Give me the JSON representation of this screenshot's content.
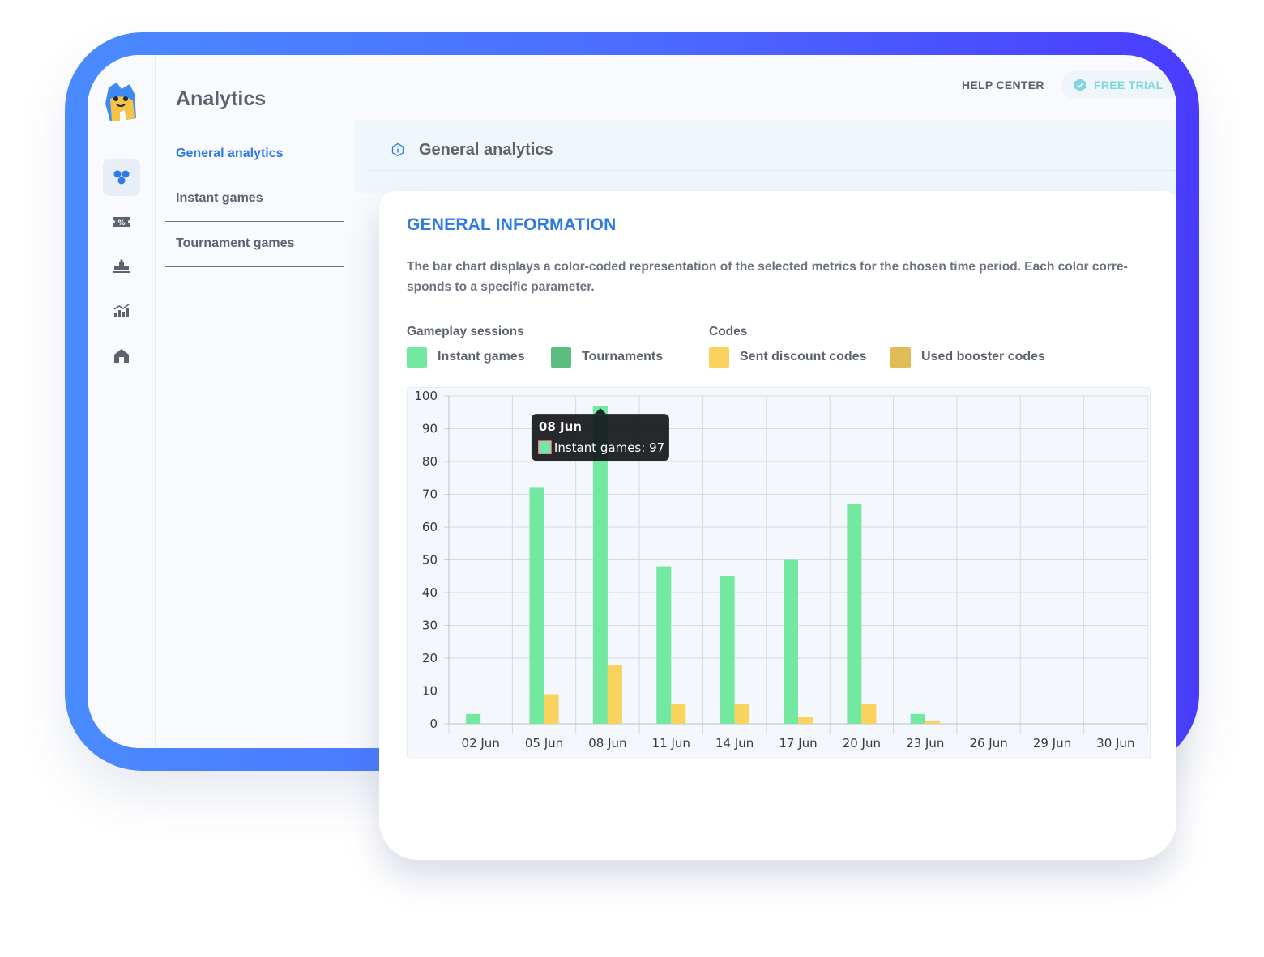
{
  "app": {
    "page_title": "Analytics",
    "help_center": "HELP CENTER",
    "free_trial": "FREE TRIAL",
    "accent_color": "#2f7ae5",
    "frame_gradient": [
      "#4a8bff",
      "#4a3cff"
    ]
  },
  "rail": {
    "items": [
      {
        "icon": "dashboard-dots-icon",
        "active": true
      },
      {
        "icon": "discount-ticket-icon",
        "active": false
      },
      {
        "icon": "podium-icon",
        "active": false
      },
      {
        "icon": "analytics-bars-icon",
        "active": false
      },
      {
        "icon": "home-icon",
        "active": false
      }
    ]
  },
  "subnav": {
    "items": [
      {
        "label": "General analytics",
        "active": true
      },
      {
        "label": "Instant games",
        "active": false
      },
      {
        "label": "Tournament games",
        "active": false
      }
    ]
  },
  "content": {
    "header_title": "General analytics",
    "card_title": "GENERAL INFORMATION",
    "description": "The bar chart displays a color-coded representation of the selected metrics for the chosen time period. Each color corre-sponds to a specific parameter."
  },
  "legend": {
    "groups": [
      {
        "title": "Gameplay sessions",
        "items": [
          {
            "label": "Instant games",
            "color": "#72e8a1"
          },
          {
            "label": "Tournaments",
            "color": "#5bbd7f"
          }
        ]
      },
      {
        "title": "Codes",
        "items": [
          {
            "label": "Sent discount codes",
            "color": "#fad35e"
          },
          {
            "label": "Used booster codes",
            "color": "#e1bb55"
          }
        ]
      }
    ]
  },
  "chart_data": {
    "type": "bar",
    "categories": [
      "02 Jun",
      "05 Jun",
      "08 Jun",
      "11 Jun",
      "14 Jun",
      "17 Jun",
      "20 Jun",
      "23 Jun",
      "26 Jun",
      "29 Jun",
      "30 Jun"
    ],
    "series": [
      {
        "name": "Instant games",
        "color": "#72e8a1",
        "values": [
          3,
          72,
          97,
          48,
          45,
          50,
          67,
          3,
          0,
          0,
          0
        ]
      },
      {
        "name": "Sent discount codes",
        "color": "#fad35e",
        "values": [
          0,
          9,
          18,
          6,
          6,
          2,
          6,
          1,
          0,
          0,
          0
        ]
      }
    ],
    "ylim": [
      0,
      100
    ],
    "yticks": [
      0,
      10,
      20,
      30,
      40,
      50,
      60,
      70,
      80,
      90,
      100
    ],
    "grid": true,
    "tooltip": {
      "title": "08 Jun",
      "label": "Instant games: 97",
      "category": "08 Jun"
    }
  }
}
